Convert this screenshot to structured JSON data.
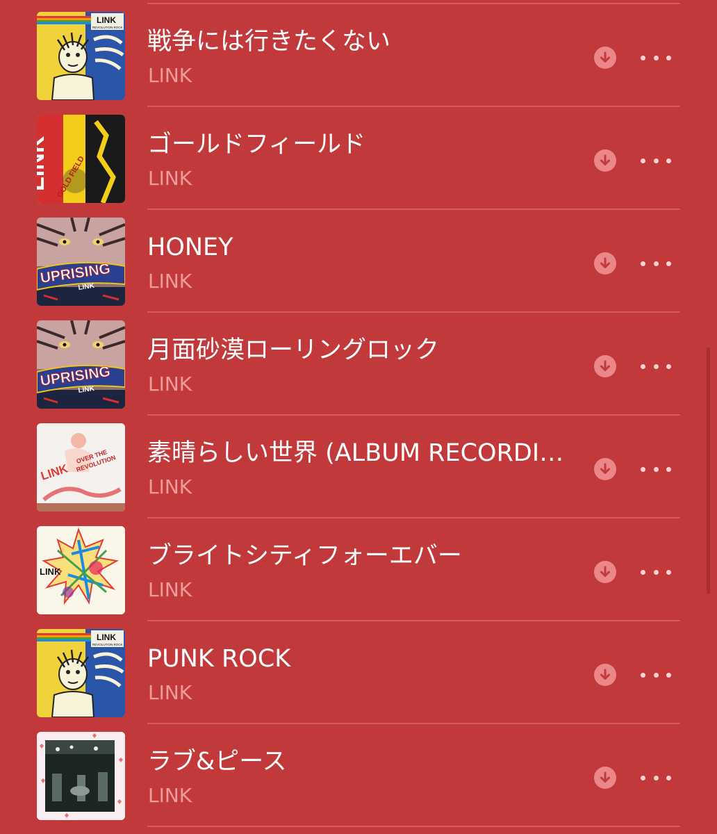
{
  "songs": [
    {
      "title": "戦争には行きたくない",
      "artist": "LINK",
      "art": "revolution-rock"
    },
    {
      "title": "ゴールドフィールド",
      "artist": "LINK",
      "art": "gold-field"
    },
    {
      "title": "HONEY",
      "artist": "LINK",
      "art": "uprising"
    },
    {
      "title": "月面砂漠ローリングロック",
      "artist": "LINK",
      "art": "uprising"
    },
    {
      "title": "素晴らしい世界 (ALBUM RECORDING)",
      "artist": "LINK",
      "art": "over-the-revolution"
    },
    {
      "title": "ブライトシティフォーエバー",
      "artist": "LINK",
      "art": "bright-city"
    },
    {
      "title": "PUNK ROCK",
      "artist": "LINK",
      "art": "revolution-rock"
    },
    {
      "title": "ラブ&ピース",
      "artist": "LINK",
      "art": "love-and-peace"
    }
  ],
  "art_text": {
    "revolution_rock_band": "LINK",
    "revolution_rock_album": "REVOLUTION ROCK",
    "gold_field_band": "LINK",
    "gold_field_album": "GOLD FIELD",
    "uprising_album": "UPRISING",
    "uprising_band": "LINK",
    "over_band": "LINK",
    "over_album_line1": "OVER THE",
    "over_album_line2": "REVOLUTION",
    "bright_band": "LINK"
  },
  "icons": {
    "download": "download-icon",
    "more": "more-icon"
  },
  "colors": {
    "background": "#c1393b",
    "title": "#ffffff",
    "artist": "#ef9a9b",
    "divider": "#d55c5d",
    "download_circle": "#eb8789"
  }
}
